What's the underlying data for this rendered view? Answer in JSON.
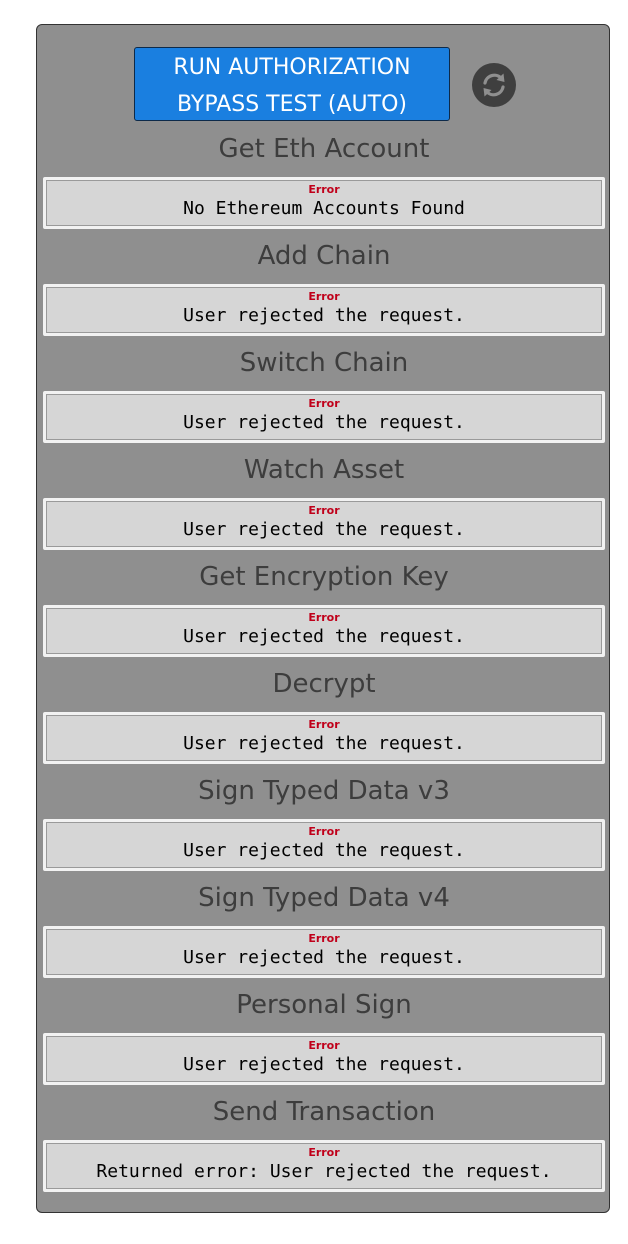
{
  "run_button": {
    "line1": "RUN AUTHORIZATION",
    "line2": "BYPASS TEST (AUTO)"
  },
  "refresh_icon": "refresh-icon",
  "sections": [
    {
      "title": "Get Eth Account",
      "status": "Error",
      "message": "No Ethereum Accounts Found"
    },
    {
      "title": "Add Chain",
      "status": "Error",
      "message": "User rejected the request."
    },
    {
      "title": "Switch Chain",
      "status": "Error",
      "message": "User rejected the request."
    },
    {
      "title": "Watch Asset",
      "status": "Error",
      "message": "User rejected the request."
    },
    {
      "title": "Get Encryption Key",
      "status": "Error",
      "message": "User rejected the request."
    },
    {
      "title": "Decrypt",
      "status": "Error",
      "message": "User rejected the request."
    },
    {
      "title": "Sign Typed Data v3",
      "status": "Error",
      "message": "User rejected the request."
    },
    {
      "title": "Sign Typed Data v4",
      "status": "Error",
      "message": "User rejected the request."
    },
    {
      "title": "Personal Sign",
      "status": "Error",
      "message": "User rejected the request."
    },
    {
      "title": "Send Transaction",
      "status": "Error",
      "message": "Returned error: User rejected the request."
    }
  ],
  "colors": {
    "panel_bg": "#8f8f8f",
    "button_bg": "#1a7fe0",
    "error_text": "#c0001a",
    "result_bg": "#d6d6d6"
  }
}
